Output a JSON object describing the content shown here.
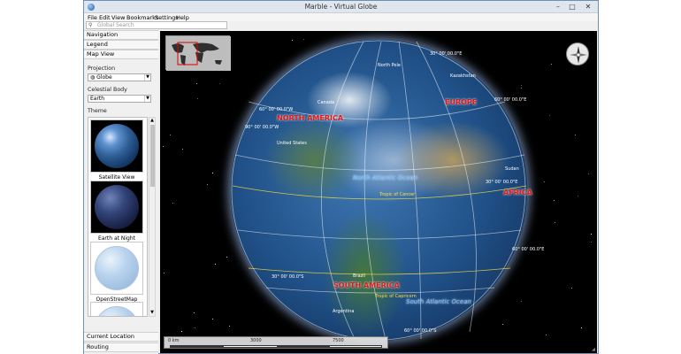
{
  "window": {
    "title": "Marble - Virtual Globe",
    "minimize": "–",
    "maximize": "□",
    "close": "✕"
  },
  "menu": [
    "File",
    "Edit",
    "View",
    "Bookmarks",
    "Settings",
    "Help"
  ],
  "search": {
    "placeholder": "Global Search"
  },
  "panel": {
    "sections_top": [
      "Navigation",
      "Legend",
      "Map View"
    ],
    "projection_label": "Projection",
    "projection_value": "Globe",
    "celestial_label": "Celestial Body",
    "celestial_value": "Earth",
    "theme_label": "Theme",
    "themes": [
      "Satellite View",
      "Earth at Night",
      "OpenStreetMap"
    ],
    "sections_bottom": [
      "Current Location",
      "Routing"
    ]
  },
  "map": {
    "continents": [
      "NORTH AMERICA",
      "EUROPE",
      "AFRICA",
      "SOUTH AMERICA"
    ],
    "oceans": [
      "North Atlantic Ocean",
      "South Atlantic Ocean"
    ],
    "tropics": [
      "Tropic of Cancer",
      "Tropic of Capricorn"
    ],
    "places": [
      "North Pole",
      "Kazakhstan",
      "Canada",
      "United States",
      "Sudan",
      "Brazil",
      "Argentina"
    ],
    "coords": [
      "30° 00' 00.0\"E",
      "60° 00' 00.0\"E",
      "30° 00' 00.0\"E",
      "60° 00' 00.0\"E",
      "60° 00' 00.0\"W",
      "90° 00' 00.0\"W",
      "30° 00' 00.0\"S",
      "60° 00' 00.0\"S"
    ],
    "scale": [
      "0 km",
      "3000",
      "7500"
    ]
  },
  "colors": {
    "continent_label": "#e01818",
    "ocean_label": "#6fb7ff",
    "tropic_label": "#ffe23a",
    "grid": "#ffffff"
  }
}
